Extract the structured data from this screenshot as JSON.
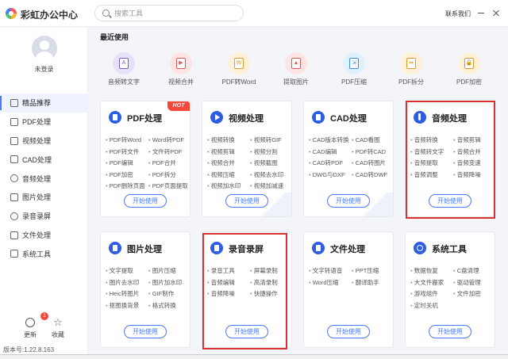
{
  "app": {
    "title": "彩虹办公中心"
  },
  "search": {
    "placeholder": "搜索工具"
  },
  "header": {
    "contact": "联系我们"
  },
  "sidebar": {
    "login": "未登录",
    "items": [
      {
        "label": "精品推荐",
        "active": true
      },
      {
        "label": "PDF处理"
      },
      {
        "label": "视频处理"
      },
      {
        "label": "CAD处理"
      },
      {
        "label": "音频处理"
      },
      {
        "label": "图片处理"
      },
      {
        "label": "录音录屏"
      },
      {
        "label": "文件处理"
      },
      {
        "label": "系统工具"
      }
    ],
    "update_label": "更新",
    "update_badge": "1",
    "favorite_label": "收藏",
    "version": "版本号:1.22.8.163"
  },
  "recent": {
    "title": "最近使用",
    "items": [
      {
        "label": "音频转文字",
        "icon": "A",
        "color": "#e9e1fb",
        "stroke": "#7a5ad8"
      },
      {
        "label": "视频合并",
        "icon": "▶",
        "color": "#fde3e3",
        "stroke": "#e05a5a"
      },
      {
        "label": "PDF转Word",
        "icon": "W",
        "color": "#fff0d9",
        "stroke": "#e09a2a"
      },
      {
        "label": "提取图片",
        "icon": "▲",
        "color": "#fde3e3",
        "stroke": "#e05a5a"
      },
      {
        "label": "PDF压缩",
        "icon": "⇲",
        "color": "#e0f0fd",
        "stroke": "#3a8ee0"
      },
      {
        "label": "PDF拆分",
        "icon": "⇹",
        "color": "#fff0d9",
        "stroke": "#e09a2a"
      },
      {
        "label": "PDF加密",
        "icon": "🔒",
        "color": "#fff0d9",
        "stroke": "#e09a2a"
      }
    ]
  },
  "cards": [
    {
      "title": "PDF处理",
      "hot": "HOT",
      "items": [
        "PDF转Word",
        "Word转PDF",
        "PDF转文件",
        "文件转PDF",
        "PDF编辑",
        "PDF合并",
        "PDF加密",
        "PDF拆分",
        "PDF删除页面",
        "PDF页面提取"
      ]
    },
    {
      "title": "视频处理",
      "items": [
        "视频转换",
        "视频转GIF",
        "视频剪辑",
        "视频分割",
        "视频合并",
        "视频截图",
        "视频压缩",
        "视频去水印",
        "视频加水印",
        "视频加减速"
      ]
    },
    {
      "title": "CAD处理",
      "items": [
        "CAD版本转换",
        "CAD看图",
        "CAD编辑",
        "PDF转CAD",
        "CAD转PDF",
        "CAD转图片",
        "DWG与DXF",
        "CAD转DWF"
      ]
    },
    {
      "title": "音频处理",
      "items": [
        "音频转换",
        "音频剪辑",
        "音频转文字",
        "音频合并",
        "音频提取",
        "音频变速",
        "音频调整",
        "音频降噪"
      ]
    },
    {
      "title": "图片处理",
      "items": [
        "文字提取",
        "图片压缩",
        "图片去水印",
        "图片加水印",
        "Heic转图片",
        "GIF制作",
        "抠图换背景",
        "格式转换"
      ]
    },
    {
      "title": "录音录屏",
      "items": [
        "录音工具",
        "屏幕录制",
        "音频编辑",
        "高清录制",
        "音频降噪",
        "快捷操作"
      ]
    },
    {
      "title": "文件处理",
      "items": [
        "文字转语音",
        "PPT压缩",
        "Word压缩",
        "翻译助手"
      ]
    },
    {
      "title": "系统工具",
      "items": [
        "数据恢复",
        "C盘清理",
        "大文件搬家",
        "驱动管理",
        "游戏组件",
        "文件加密",
        "定时关机"
      ]
    }
  ],
  "start_label": "开始使用"
}
